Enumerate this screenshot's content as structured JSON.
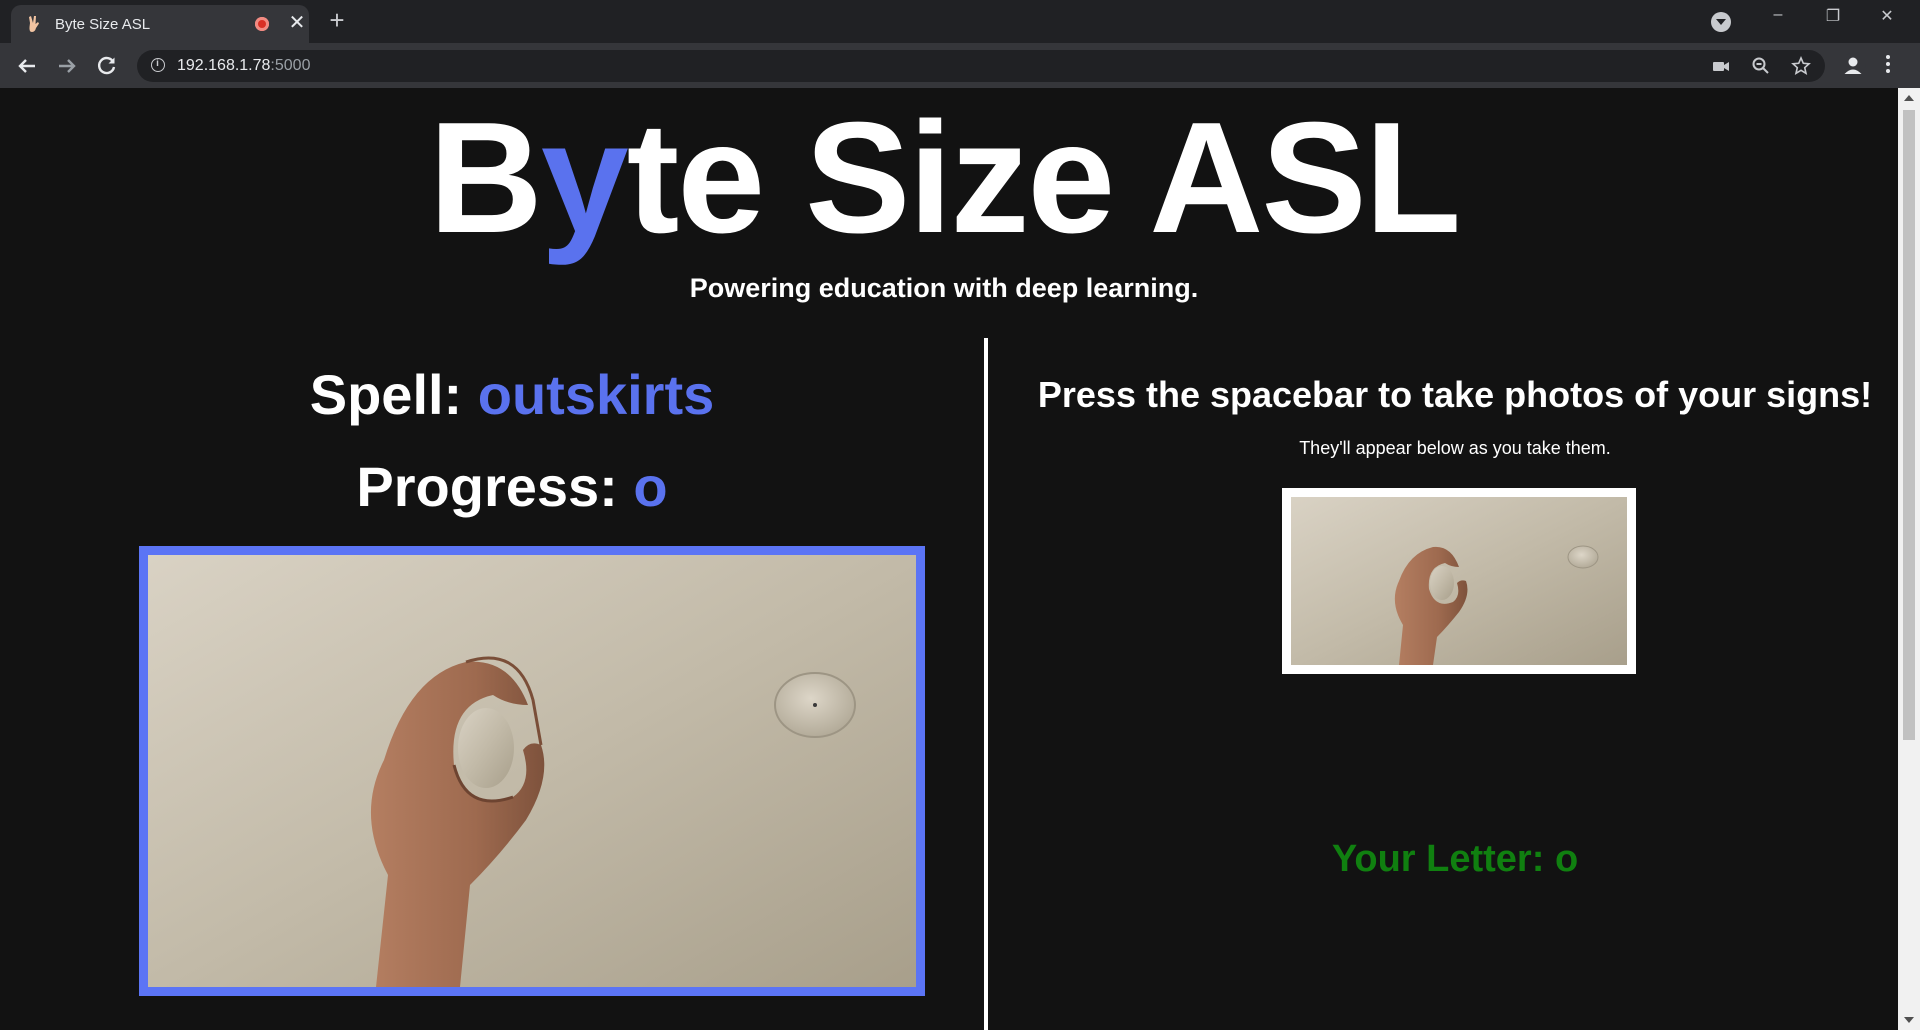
{
  "browser": {
    "tab_title": "Byte Size ASL",
    "new_tab_symbol": "+",
    "close_symbol": "✕",
    "url_host": "192.168.1.78",
    "url_port": ":5000",
    "window_controls": {
      "minimize": "–",
      "restore": "❐",
      "close": "✕"
    },
    "icons": [
      "tab-favicon-hand-icon",
      "recording-icon",
      "tab-close-icon",
      "new-tab-icon",
      "tab-search-icon",
      "back-icon",
      "forward-icon",
      "reload-icon",
      "site-info-icon",
      "camera-icon",
      "zoom-icon",
      "bookmark-star-icon",
      "profile-icon",
      "menu-icon"
    ]
  },
  "header": {
    "brand_prefix": "B",
    "brand_accent": "y",
    "brand_suffix": "te Size ASL",
    "tagline": "Powering education with deep learning."
  },
  "left": {
    "spell_label": "Spell: ",
    "spell_word": "outskirts",
    "progress_label": "Progress: ",
    "progress_value": "o"
  },
  "right": {
    "instruction": "Press the spacebar to take photos of your signs!",
    "subinstruction": "They'll appear below as you take them.",
    "your_letter_label": "Your Letter: ",
    "your_letter_value": "o"
  },
  "colors": {
    "accent": "#5a72ee",
    "webcam_border": "#5b74f5",
    "letter_green": "#108010",
    "background": "#121212"
  }
}
